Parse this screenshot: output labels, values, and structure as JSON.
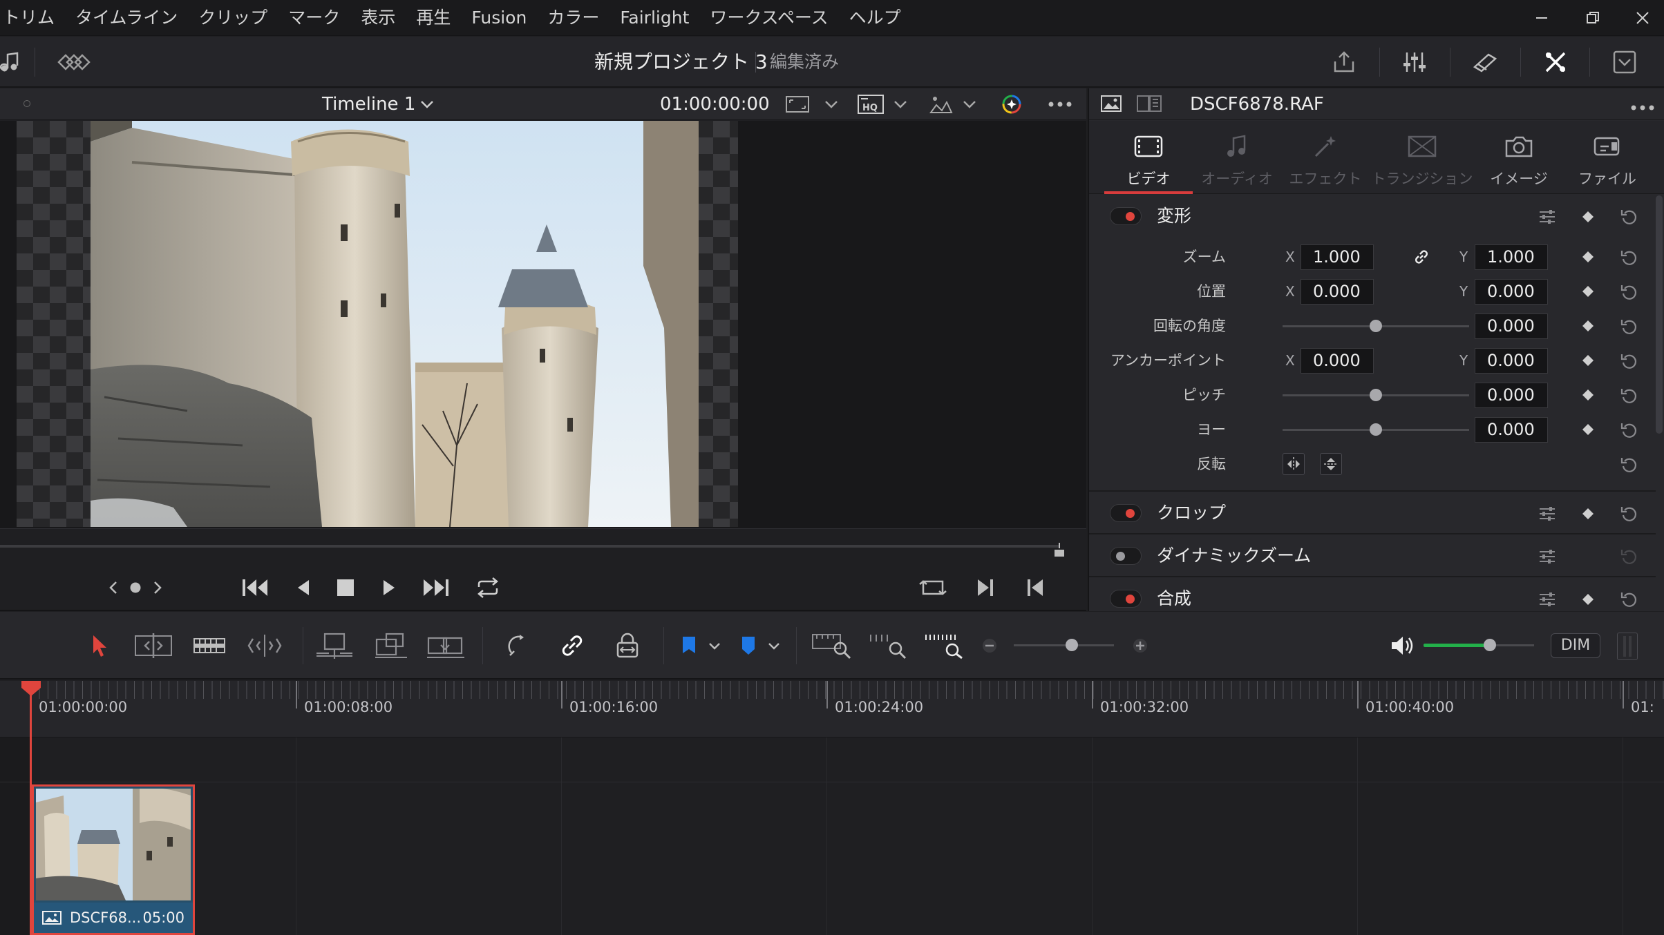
{
  "menu": {
    "items": [
      "トリム",
      "タイムライン",
      "クリップ",
      "マーク",
      "表示",
      "再生",
      "Fusion",
      "カラー",
      "Fairlight",
      "ワークスペース",
      "ヘルプ"
    ]
  },
  "window_controls": [
    "minimize-icon",
    "restore-icon",
    "close-icon"
  ],
  "title_bar": {
    "project_name": "新規プロジェクト 3",
    "status": "編集済み",
    "right_icons": [
      "export-icon",
      "mixer-icon",
      "effects-icon",
      "inspector-icon",
      "expand-icon"
    ]
  },
  "viewer": {
    "timeline_name": "Timeline 1",
    "timecode": "01:00:00:00",
    "header_icons": [
      "viewer-size-icon",
      "hq-icon",
      "overlay-icon",
      "color-wheel-icon",
      "more-icon"
    ]
  },
  "transport": {
    "buttons": [
      "jog-left",
      "jog-dot",
      "jog-right",
      "go-first",
      "prev-frame",
      "stop",
      "play",
      "go-last",
      "loop"
    ],
    "right_buttons": [
      "match-frame-icon",
      "next-edit-icon",
      "prev-edit-icon"
    ]
  },
  "inspector": {
    "clip_name": "DSCF6878.RAF",
    "tabs": [
      {
        "label": "ビデオ",
        "icon": "video-icon",
        "active": true
      },
      {
        "label": "オーディオ",
        "icon": "music-note-icon",
        "active": false
      },
      {
        "label": "エフェクト",
        "icon": "magic-wand-icon",
        "active": false
      },
      {
        "label": "トランジション",
        "icon": "transition-icon",
        "active": false
      },
      {
        "label": "イメージ",
        "icon": "camera-icon",
        "active": false
      },
      {
        "label": "ファイル",
        "icon": "file-icon",
        "active": false
      }
    ],
    "transform": {
      "title": "変形",
      "enabled": true,
      "zoom": {
        "label": "ズーム",
        "x_axis": "X",
        "x": "1.000",
        "y_axis": "Y",
        "y": "1.000"
      },
      "position": {
        "label": "位置",
        "x_axis": "X",
        "x": "0.000",
        "y_axis": "Y",
        "y": "0.000"
      },
      "rotation": {
        "label": "回転の角度",
        "value": "0.000",
        "slider": 0.5
      },
      "anchor": {
        "label": "アンカーポイント",
        "x_axis": "X",
        "x": "0.000",
        "y_axis": "Y",
        "y": "0.000"
      },
      "pitch": {
        "label": "ピッチ",
        "value": "0.000",
        "slider": 0.5
      },
      "yaw": {
        "label": "ヨー",
        "value": "0.000",
        "slider": 0.5
      },
      "flip": {
        "label": "反転"
      }
    },
    "sections": [
      {
        "title": "クロップ",
        "enabled": true
      },
      {
        "title": "ダイナミックズーム",
        "enabled": false
      },
      {
        "title": "合成",
        "enabled": true
      }
    ]
  },
  "timeline_toolbar": {
    "tools": [
      "selection-arrow-icon",
      "trim-edit-icon",
      "dynamic-trim-icon",
      "blade-icon",
      "insert-clip-icon",
      "overwrite-clip-icon",
      "replace-clip-icon",
      "snapping-icon",
      "linked-selection-icon",
      "position-lock-icon",
      "flag-icon",
      "marker-icon",
      "zoom-full-icon",
      "zoom-detail-icon",
      "zoom-custom-icon"
    ],
    "zoom_level": 0.58,
    "volume_level": 0.6,
    "dim_label": "DIM"
  },
  "timeline": {
    "ruler_labels": [
      "01:00:00:00",
      "01:00:08:00",
      "01:00:16:00",
      "01:00:24:00",
      "01:00:32:00",
      "01:00:40:00",
      "01:"
    ],
    "clip": {
      "name": "DSCF68...",
      "duration": "05:00"
    }
  },
  "colors": {
    "accent_red": "#e0453d",
    "clip_blue": "#26577a",
    "volume_green": "#23b04a",
    "flag_blue": "#1e78e6"
  }
}
